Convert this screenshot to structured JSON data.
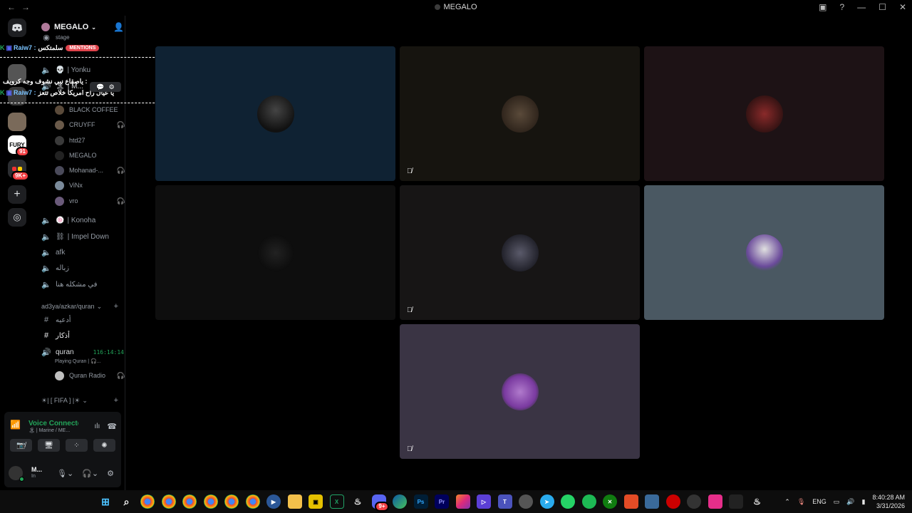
{
  "window": {
    "title": "MEGALO",
    "nav_back": "←",
    "nav_forward": "→"
  },
  "rail": {
    "items": [
      {
        "name": "discord-home",
        "label": ""
      },
      {
        "name": "server-fury",
        "label": "FURY",
        "badge": "91"
      },
      {
        "name": "server-folder",
        "label": "",
        "badge": "9K+"
      }
    ],
    "add": "+",
    "explore": "◎"
  },
  "server": {
    "name": "MEGALO",
    "add_member": "👤+"
  },
  "channels": {
    "stage": "stage",
    "c_yonku": "| Yonku",
    "c_marine": "| M...",
    "members": [
      {
        "name": "BLACK COFFEE",
        "muted": false
      },
      {
        "name": "CRUYFF",
        "muted": true
      },
      {
        "name": "htd27",
        "muted": false
      },
      {
        "name": "MEGALO",
        "muted": false
      },
      {
        "name": "Mohanad-...",
        "muted": true
      },
      {
        "name": "ViNx",
        "muted": false
      },
      {
        "name": "vro",
        "muted": true
      }
    ],
    "c_konoha": "| Konoha",
    "c_impel": "| Impel Down",
    "c_afk": "afk",
    "c_zbala": "زباله",
    "c_mushkila": "في مشكله هنا",
    "category_quran": "ad3ya/azkar/quran",
    "text_ad3ya": "أدعيه",
    "text_azkar": "أذكار",
    "quran_voice": "quran",
    "quran_timer": "116:14:14",
    "quran_playing": "Playing Quran | 🎧...",
    "quran_radio": "Quran Radio",
    "category_fifa": "☀| [ FIFA ] |☀"
  },
  "overlay": {
    "line1_user": "Raiw7 :",
    "line1_text": "سلمتكس",
    "mentions": "MENTIONS",
    "line2_text": "ياصقاع نبي نشوف وجه كرويف :",
    "line3_user": "Raiw7 :",
    "line3_text": "يا عيال راح امريكا خلاص تتعز",
    "dashes": "++++++++++++++++++++++++++++++++++++++++++++++"
  },
  "voice_panel": {
    "status": "Voice Connected",
    "channel": "🏝 | Marine / ME..."
  },
  "user": {
    "name": "M...",
    "status": "In"
  },
  "tiles": [
    {
      "bg": "#0f2233",
      "muted": false
    },
    {
      "bg": "#16140f",
      "muted": true
    },
    {
      "bg": "#1d1215",
      "muted": false
    },
    {
      "bg": "#0e0e0e",
      "muted": false
    },
    {
      "bg": "#171515",
      "muted": true
    },
    {
      "bg": "#4a5862",
      "muted": false
    },
    {
      "bg": "#3a3444",
      "muted": true
    }
  ],
  "taskbar": {
    "lang": "ENG",
    "time": "8:40:28 AM",
    "date": "3/31/2026",
    "discord_badge": "9+"
  }
}
